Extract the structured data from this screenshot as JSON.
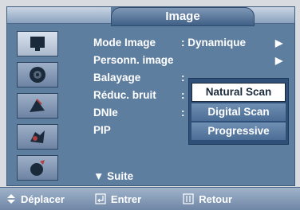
{
  "title": "Image",
  "icons": [
    "tv-icon",
    "speaker-icon",
    "satellite-icon",
    "gear-icon",
    "setup-icon"
  ],
  "menu": [
    {
      "label": "Mode Image",
      "value": ": Dynamique",
      "arrow": "▶"
    },
    {
      "label": "Personn. image",
      "value": "",
      "arrow": "▶"
    },
    {
      "label": "Balayage",
      "value": ":",
      "arrow": ""
    },
    {
      "label": "Réduc. bruit",
      "value": ":",
      "arrow": ""
    },
    {
      "label": "DNIe",
      "value": ":",
      "arrow": ""
    },
    {
      "label": "PIP",
      "value": "",
      "arrow": ""
    }
  ],
  "popup": {
    "options": [
      "Natural Scan",
      "Digital Scan",
      "Progressive"
    ],
    "selected": "Natural Scan"
  },
  "suite": "▼ Suite",
  "footer": {
    "move": "Déplacer",
    "enter": "Entrer",
    "back": "Retour"
  }
}
